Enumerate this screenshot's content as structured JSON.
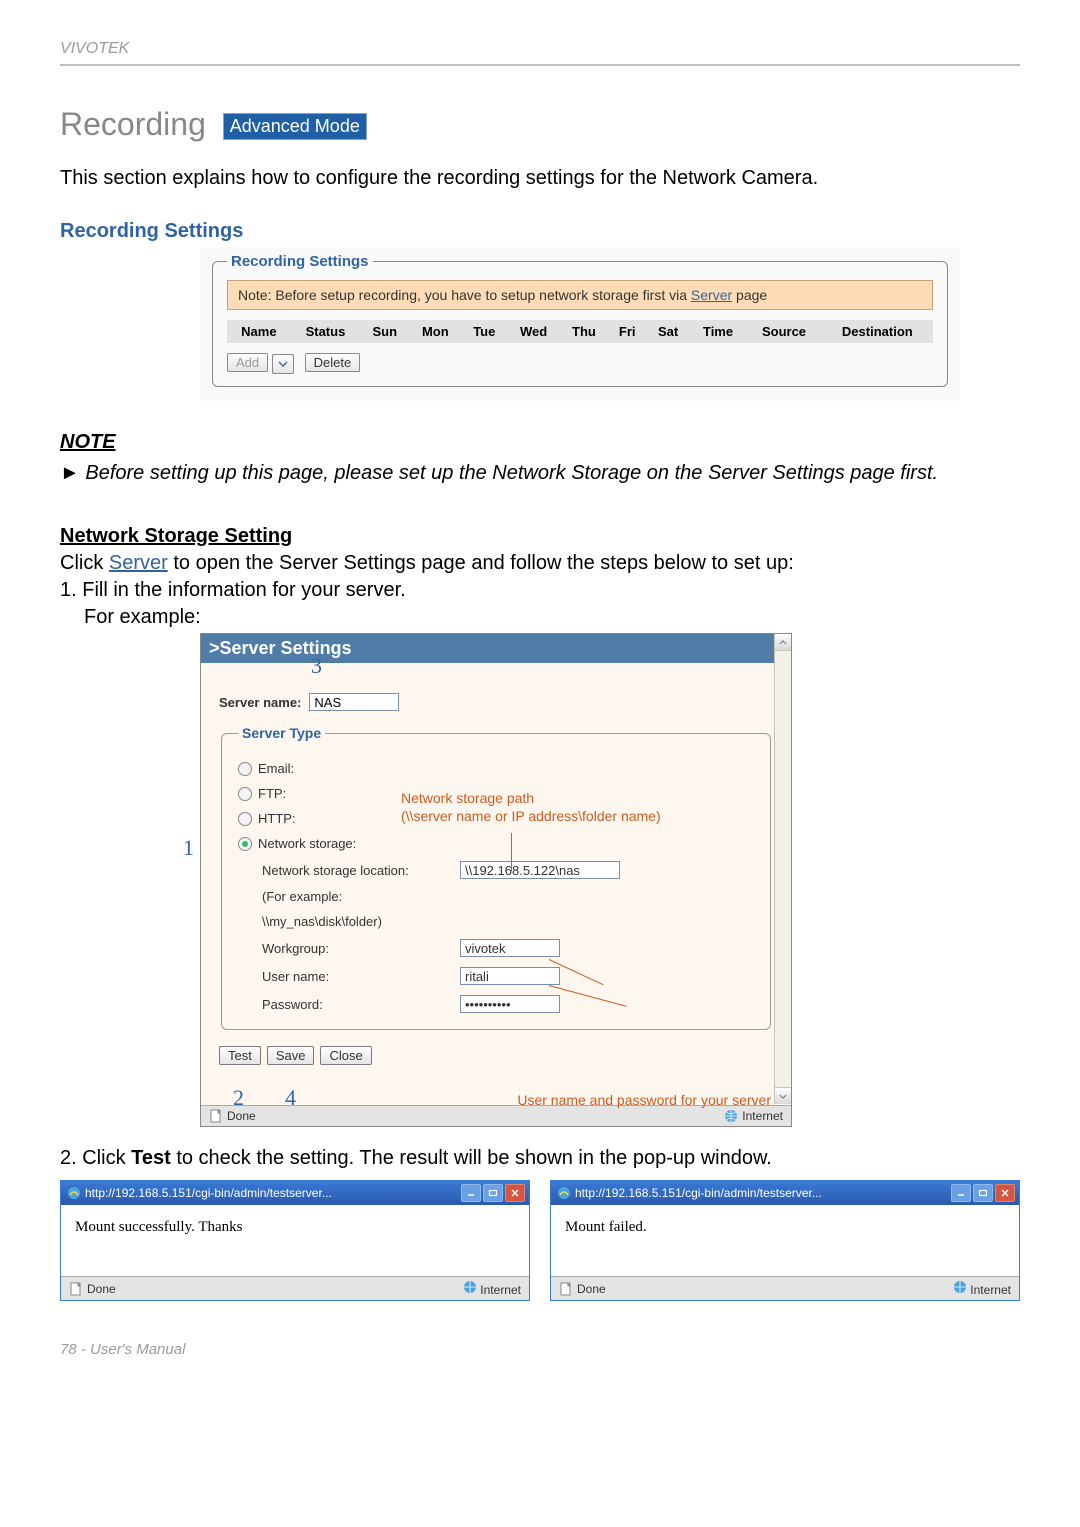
{
  "header": {
    "brand": "VIVOTEK"
  },
  "title": {
    "main": "Recording",
    "badge": "Advanced Mode"
  },
  "intro": "This section explains how to configure the recording settings for the Network Camera.",
  "subheading": "Recording Settings",
  "rec_panel": {
    "legend": "Recording Settings",
    "note_prefix": "Note: Before setup recording, you have to setup network storage first via ",
    "note_link": "Server",
    "note_suffix": " page",
    "cols": [
      "Name",
      "Status",
      "Sun",
      "Mon",
      "Tue",
      "Wed",
      "Thu",
      "Fri",
      "Sat",
      "Time",
      "Source",
      "Destination"
    ],
    "btn_add": "Add",
    "btn_delete": "Delete"
  },
  "note": {
    "heading": "NOTE",
    "marker": "►",
    "body": " Before setting up this page, please set up the Network Storage on the Server Settings page first."
  },
  "nss": {
    "heading": "Network Storage Setting",
    "line1_pre": "Click ",
    "line1_link": "Server",
    "line1_post": " to open the Server Settings page and follow the steps below to set up:",
    "step1": "1. Fill in the information for your server.",
    "for_example": "For example:"
  },
  "server_settings": {
    "panel_title": ">Server Settings",
    "name_label": "Server name:",
    "name_value": "NAS",
    "legend": "Server Type",
    "radio_email": "Email:",
    "radio_ftp": "FTP:",
    "radio_http": "HTTP:",
    "radio_ns": "Network storage:",
    "ns_location_label": "Network storage location:",
    "ns_location_value": "\\\\192.168.5.122\\nas",
    "ns_example_label": "(For example:",
    "ns_example_value": "\\\\my_nas\\disk\\folder)",
    "workgroup_label": "Workgroup:",
    "workgroup_value": "vivotek",
    "username_label": "User name:",
    "username_value": "ritali",
    "password_label": "Password:",
    "password_value": "••••••••••",
    "btn_test": "Test",
    "btn_save": "Save",
    "btn_close": "Close",
    "status_done": "Done",
    "status_zone": "Internet"
  },
  "annotations": {
    "n1": "1",
    "n2": "2",
    "n3": "3",
    "n4": "4",
    "path_label_l1": "Network storage path",
    "path_label_l2": "(\\\\server name or IP address\\folder name)",
    "creds_label": "User name and password for your server"
  },
  "step2": {
    "pre": "2. Click ",
    "bold": "Test",
    "post": " to check the setting. The result will be shown in the pop-up window."
  },
  "popup_title": "http://192.168.5.151/cgi-bin/admin/testserver...",
  "popup_success": "Mount successfully. Thanks",
  "popup_failed": "Mount failed.",
  "popup_status_done": "Done",
  "popup_status_zone": "Internet",
  "footer": "78 - User's Manual"
}
